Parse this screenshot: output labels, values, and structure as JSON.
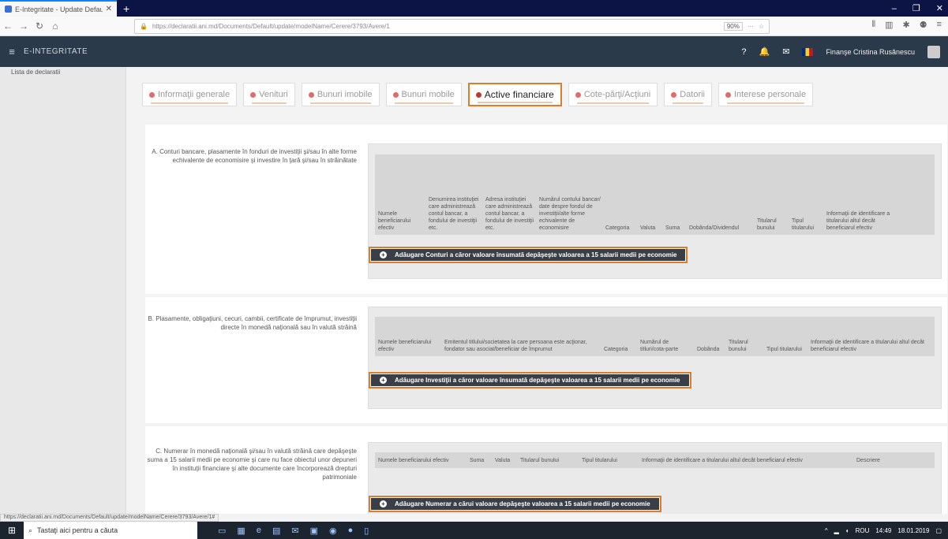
{
  "browser": {
    "tab_title": "E-Integritate - Update Default",
    "url": "https://declaratii.ani.md/Documents/Default/update/modelName/Cerere/3793/Avere/1",
    "zoom": "90%"
  },
  "app": {
    "brand": "E-INTEGRITATE",
    "user": "Finanşe Cristina Rusănescu"
  },
  "sidebar": {
    "items": [
      "Lista de declaratii"
    ]
  },
  "tabs": [
    {
      "label": "Informaţii generale",
      "active": false
    },
    {
      "label": "Venituri",
      "active": false
    },
    {
      "label": "Bunuri imobile",
      "active": false
    },
    {
      "label": "Bunuri mobile",
      "active": false
    },
    {
      "label": "Active financiare",
      "active": true
    },
    {
      "label": "Cote-părţi/Acţiuni",
      "active": false
    },
    {
      "label": "Datorii",
      "active": false
    },
    {
      "label": "Interese personale",
      "active": false
    }
  ],
  "sections": {
    "a": {
      "label": "A. Conturi bancare, plasamente în fonduri de investiţii şi/sau în alte forme echivalente de economisire şi investire în ţară şi/sau în străinătate",
      "columns": [
        "Numele beneficiarului efectiv",
        "Denumirea instituţiei care administrează contul bancar, a fondului de investiţii etc.",
        "Adresa instituţiei care administrează contul bancar, a fondului de investiţii etc.",
        "Numărul contului bancar/ date despre fondul de investiţii/alte forme echivalente de economisire",
        "Categoria",
        "Valuta",
        "Suma",
        "Dobânda/Dividendul",
        "Titularul bunului",
        "Tipul titularului",
        "Informaţii de identificare a titularului altul decât beneficiarul efectiv"
      ],
      "button": "Adăugare Conturi a căror valoare însumată depăşeşte valoarea a 15 salarii medii pe economie"
    },
    "b": {
      "label": "B. Plasamente, obligaţiuni, cecuri, cambii, certificate de împrumut, investiţii directe în monedă naţională sau în valută străină",
      "columns": [
        "Numele beneficiarului efectiv",
        "Emitentul titlului/societatea la care persoana este acţionar, fondator sau asociat/beneficiar de împrumut",
        "Categoria",
        "Numărul de titluri/cota-parte",
        "Dobânda",
        "Titularul bunului",
        "Tipul titularului",
        "Informaţii de identificare a titularului altul decât beneficiarul efectiv"
      ],
      "button": "Adăugare Investiţii a căror valoare însumată depăşeşte valoarea a 15 salarii medii pe economie"
    },
    "c": {
      "label": "C. Numerar în monedă naţională şi/sau în valută străină care depăşeşte suma a 15 salarii medii pe economie şi care nu face obiectul unor depuneri în instituţii financiare şi alte documente care încorporează drepturi patrimoniale",
      "columns": [
        "Numele beneficiarului efectiv",
        "Suma",
        "Valuta",
        "Titularul bunului",
        "Tipul titularului",
        "Informaţii de identificare a titularului altul decât beneficiarul efectiv",
        "Descriere"
      ],
      "button": "Adăugare Numerar a cărui valoare depăşeşte valoarea a 15 salarii medii pe economie"
    }
  },
  "statusbar": {
    "link": "https://declaratii.ani.md/Documents/Default/update/modelName/Cerere/3793/Avere/1#"
  },
  "taskbar": {
    "search_placeholder": "Tastaţi aici pentru a căuta",
    "lang": "ROU",
    "time": "14:49",
    "date": "18.01.2019"
  }
}
